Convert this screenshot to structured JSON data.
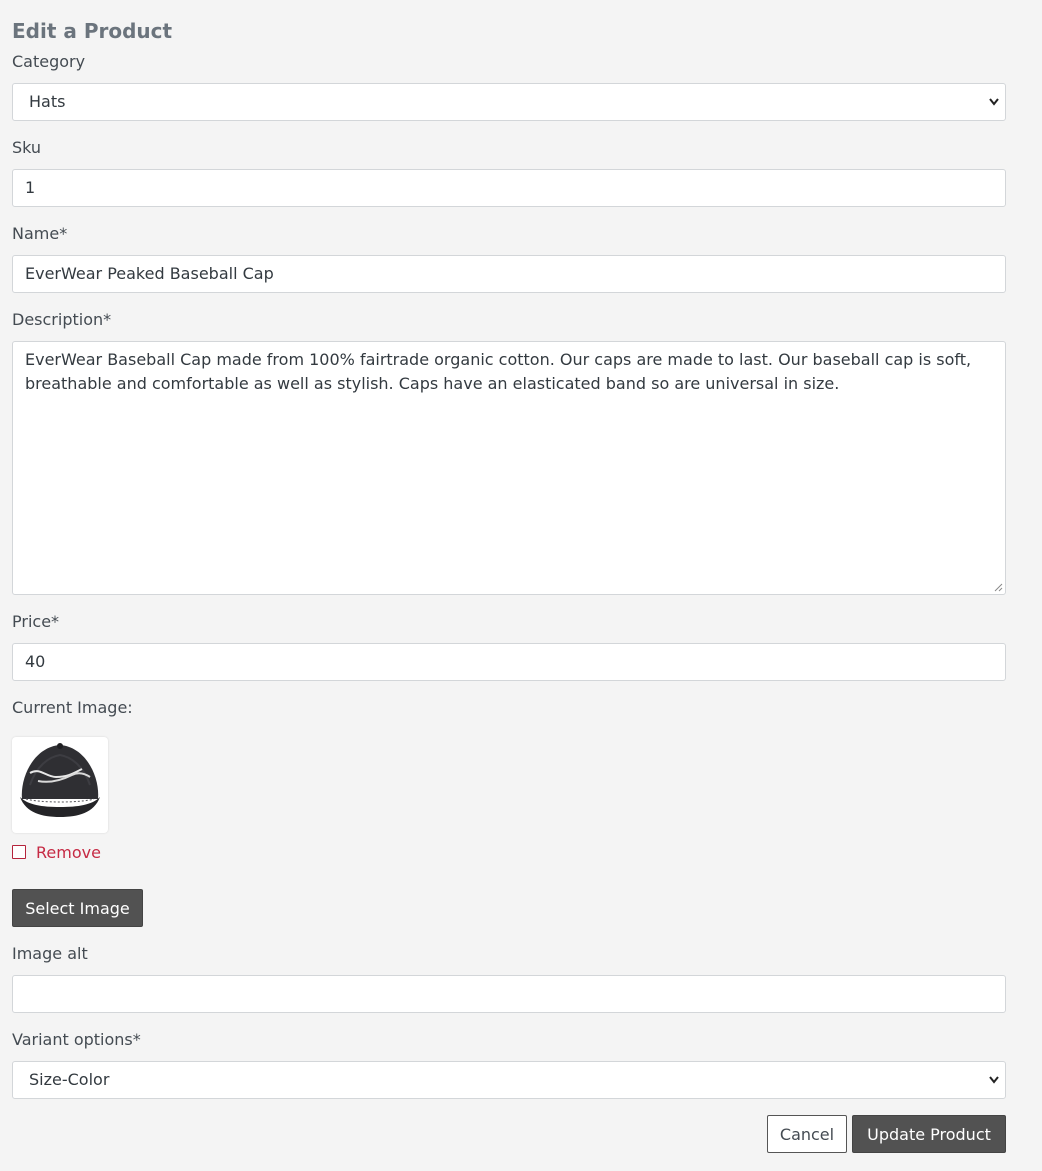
{
  "form": {
    "title": "Edit a Product",
    "category": {
      "label": "Category",
      "value": "Hats"
    },
    "sku": {
      "label": "Sku",
      "value": "1"
    },
    "name": {
      "label": "Name*",
      "value": "EverWear Peaked Baseball Cap"
    },
    "description": {
      "label": "Description*",
      "value": "EverWear Baseball Cap made from 100% fairtrade organic cotton. Our caps are made to last. Our baseball cap is soft, breathable and comfortable as well as stylish. Caps have an elasticated band so are universal in size."
    },
    "price": {
      "label": "Price*",
      "value": "40"
    },
    "current_image": {
      "label": "Current Image:",
      "icon": "baseball-cap-image"
    },
    "remove": {
      "label": "Remove",
      "checked": false
    },
    "select_image_label": "Select Image",
    "image_alt": {
      "label": "Image alt",
      "value": ""
    },
    "variant_options": {
      "label": "Variant options*",
      "value": "Size-Color"
    },
    "cancel_label": "Cancel",
    "update_label": "Update Product"
  },
  "colors": {
    "background": "#f4f4f4",
    "dark_button": "#525252",
    "remove_red": "#c62a44"
  }
}
